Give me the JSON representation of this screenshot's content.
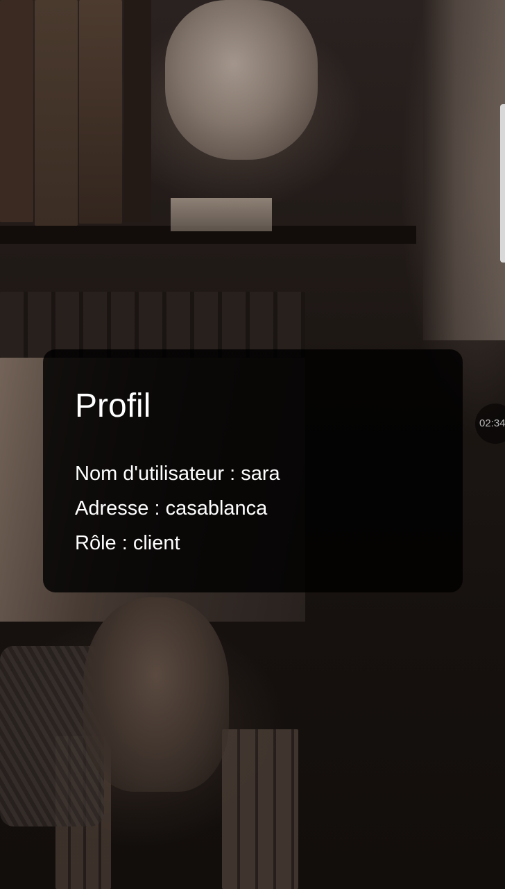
{
  "profile": {
    "title": "Profil",
    "fields": [
      {
        "label": "Nom d'utilisateur",
        "separator": " : ",
        "value": "sara"
      },
      {
        "label": "Adresse",
        "separator": " : ",
        "value": "casablanca"
      },
      {
        "label": "Rôle",
        "separator": " : ",
        "value": "client"
      }
    ]
  },
  "overlay": {
    "clock_text": "02:34"
  },
  "background": {
    "description_icon": "bookshelf-photo"
  },
  "colors": {
    "card_background": "#000000",
    "text": "#ffffff"
  }
}
